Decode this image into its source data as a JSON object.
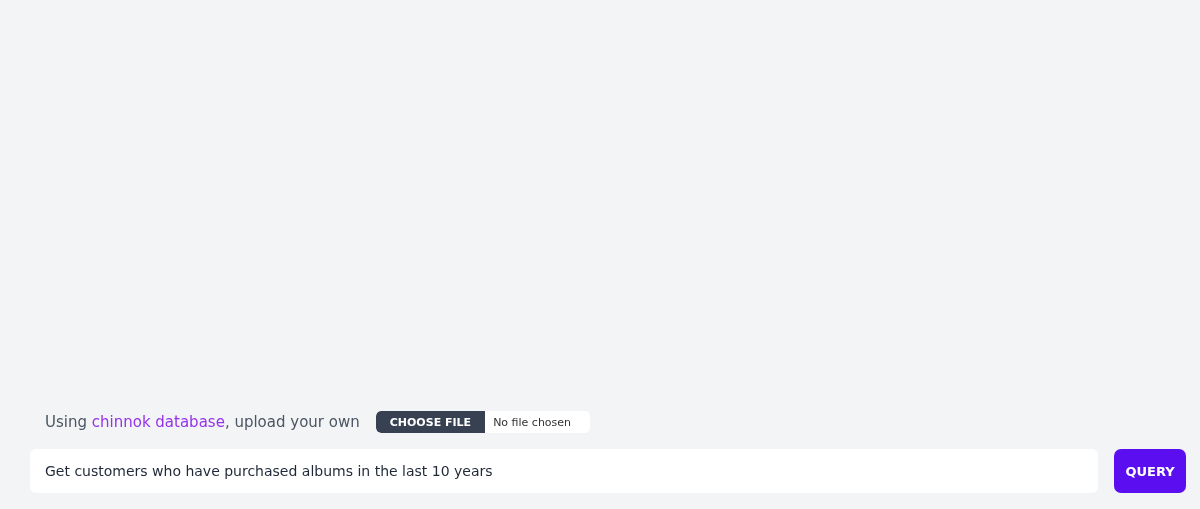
{
  "source_line": {
    "prefix": "Using ",
    "link": "chinnok database",
    "suffix": ", upload your own"
  },
  "file_picker": {
    "button": "CHOOSE FILE",
    "status": "No file chosen"
  },
  "query_field": {
    "value": "Get customers who have purchased albums in the last 10 years"
  },
  "query_button": {
    "label": "QUERY"
  }
}
